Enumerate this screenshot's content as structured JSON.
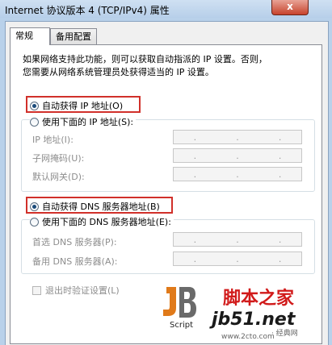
{
  "window": {
    "title": "Internet 协议版本 4 (TCP/IPv4) 属性",
    "close_label": "x"
  },
  "tabs": [
    {
      "label": "常规"
    },
    {
      "label": "备用配置"
    }
  ],
  "intro": {
    "line1": "如果网络支持此功能，则可以获取自动指派的 IP 设置。否则，",
    "line2": "您需要从网络系统管理员处获得适当的 IP 设置。"
  },
  "ip_section": {
    "auto_label": "自动获得 IP 地址(O)",
    "manual_label": "使用下面的 IP 地址(S):",
    "auto_selected": true,
    "fields": [
      {
        "label": "IP 地址(I):"
      },
      {
        "label": "子网掩码(U):"
      },
      {
        "label": "默认网关(D):"
      }
    ]
  },
  "dns_section": {
    "auto_label": "自动获得 DNS 服务器地址(B)",
    "manual_label": "使用下面的 DNS 服务器地址(E):",
    "auto_selected": true,
    "fields": [
      {
        "label": "首选 DNS 服务器(P):"
      },
      {
        "label": "备用 DNS 服务器(A):"
      }
    ]
  },
  "validate_label": "退出时验证设置(L)",
  "ip_dot": ".",
  "watermark": {
    "brand_cn": "脚本之家",
    "url": "jb51.net",
    "script_label": "Script",
    "sub_text": "· 经典网",
    "sub_url": "www.2cto.com"
  },
  "colors": {
    "highlight": "#d1302a",
    "brand_red": "#d11a1a"
  }
}
